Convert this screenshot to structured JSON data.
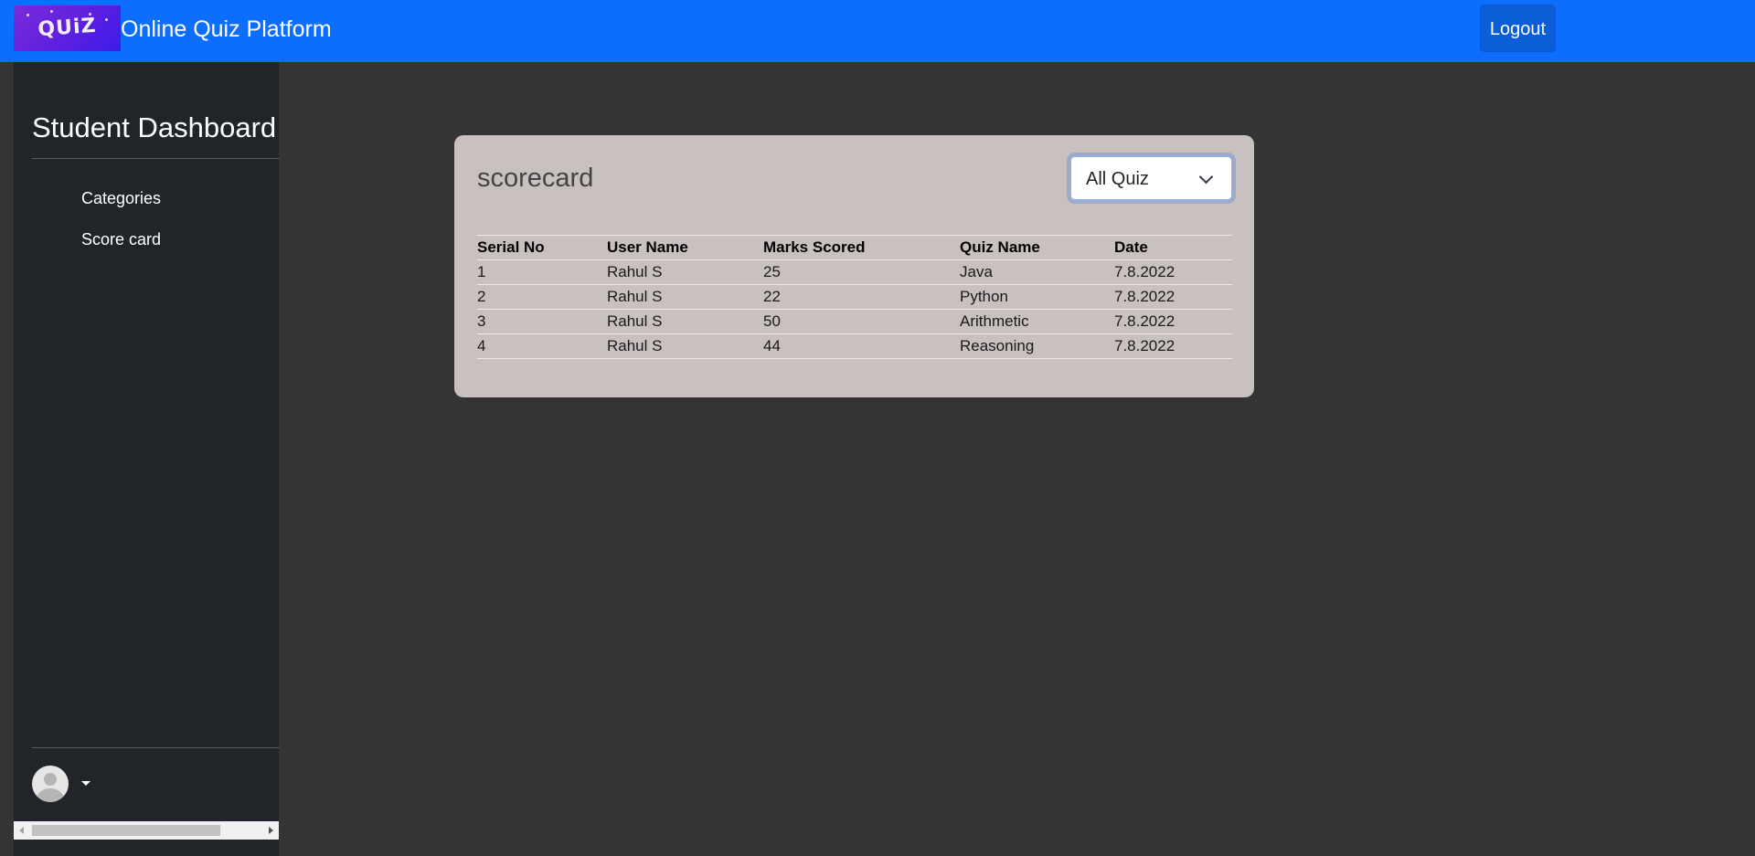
{
  "navbar": {
    "logo_text": "QUiZ",
    "title": "Online Quiz Platform",
    "logout_label": "Logout",
    "bg_color": "#0d6efd"
  },
  "sidebar": {
    "title": "Student Dashboard",
    "items": [
      {
        "label": "Categories"
      },
      {
        "label": "Score card"
      }
    ],
    "user_icon": "user-avatar-icon",
    "caret_icon": "caret-down-icon"
  },
  "scorecard": {
    "title": "scorecard",
    "filter": {
      "selected": "All Quiz",
      "icon": "chevron-down-icon"
    },
    "table": {
      "headers": [
        "Serial No",
        "User Name",
        "Marks Scored",
        "Quiz Name",
        "Date"
      ],
      "rows": [
        [
          "1",
          "Rahul S",
          "25",
          "Java",
          "7.8.2022"
        ],
        [
          "2",
          "Rahul S",
          "22",
          "Python",
          "7.8.2022"
        ],
        [
          "3",
          "Rahul S",
          "50",
          "Arithmetic",
          "7.8.2022"
        ],
        [
          "4",
          "Rahul S",
          "44",
          "Reasoning",
          "7.8.2022"
        ]
      ]
    }
  },
  "colors": {
    "page_bg": "#343434",
    "sidebar_bg": "#212529",
    "card_bg": "#c9c0c0"
  }
}
